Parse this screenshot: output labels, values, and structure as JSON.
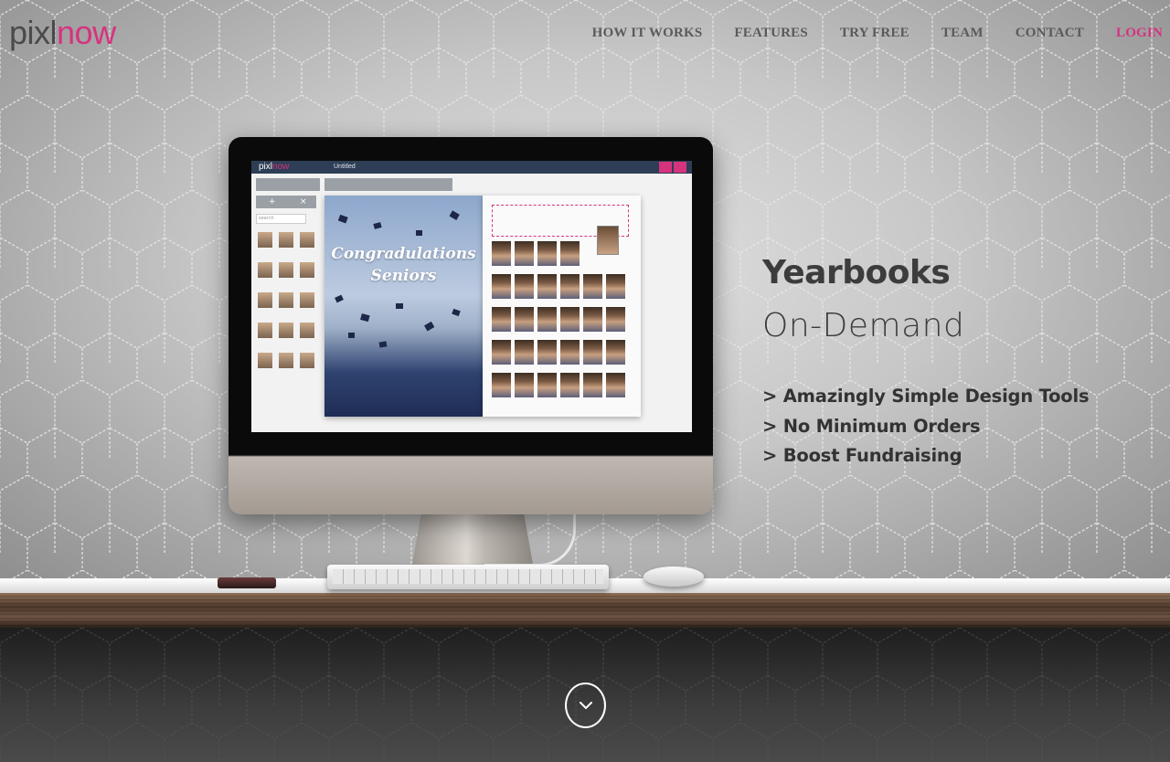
{
  "brand": {
    "logo_part1": "pixl",
    "logo_part2": "now"
  },
  "nav": [
    {
      "label": "HOW IT WORKS"
    },
    {
      "label": "FEATURES"
    },
    {
      "label": "TRY FREE"
    },
    {
      "label": "TEAM"
    },
    {
      "label": "CONTACT"
    },
    {
      "label": "LOGIN"
    }
  ],
  "hero": {
    "title": "Yearbooks",
    "subtitle": "On-Demand",
    "bullets": [
      "> Amazingly Simple Design Tools",
      "> No Minimum Orders",
      "> Boost Fundraising"
    ]
  },
  "screen": {
    "app_logo_part1": "pixl",
    "app_logo_part2": "now",
    "document_title": "Untitled",
    "search_placeholder": "search",
    "add_symbol": "+",
    "close_symbol": "×",
    "page_caption_line1": "Congradulations",
    "page_caption_line2": "Seniors"
  },
  "icons": {
    "scroll_down": "chevron-down-icon"
  },
  "colors": {
    "accent": "#d6337f",
    "nav_text": "#5a5a5a",
    "heading": "#3c3c3c"
  }
}
